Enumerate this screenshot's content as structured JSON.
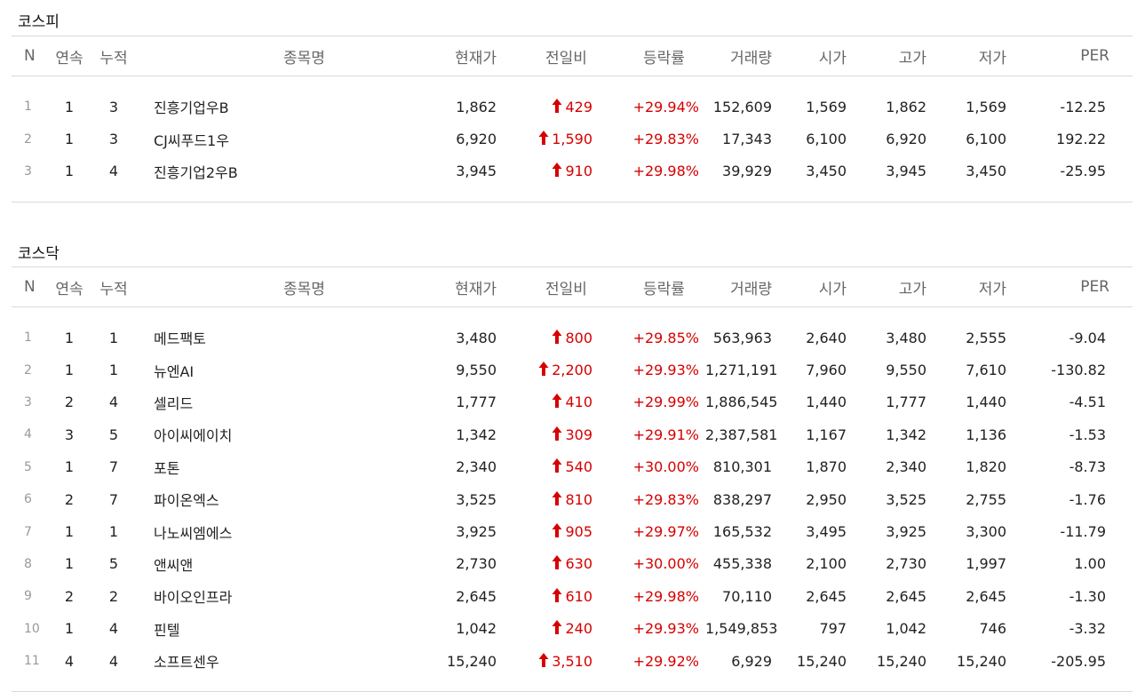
{
  "colors": {
    "up": "#d60000",
    "border": "#d9d9d9",
    "header_text": "#666666"
  },
  "kospi": {
    "title": "코스피",
    "headers": [
      "N",
      "연속",
      "누적",
      "종목명",
      "현재가",
      "전일비",
      "등락률",
      "거래량",
      "시가",
      "고가",
      "저가",
      "PER"
    ],
    "rows": [
      {
        "n": "1",
        "streak": "1",
        "total": "3",
        "name": "진흥기업우B",
        "price": "1,862",
        "change": "429",
        "rate": "+29.94%",
        "volume": "152,609",
        "open": "1,569",
        "high": "1,862",
        "low": "1,569",
        "per": "-12.25"
      },
      {
        "n": "2",
        "streak": "1",
        "total": "3",
        "name": "CJ씨푸드1우",
        "price": "6,920",
        "change": "1,590",
        "rate": "+29.83%",
        "volume": "17,343",
        "open": "6,100",
        "high": "6,920",
        "low": "6,100",
        "per": "192.22"
      },
      {
        "n": "3",
        "streak": "1",
        "total": "4",
        "name": "진흥기업2우B",
        "price": "3,945",
        "change": "910",
        "rate": "+29.98%",
        "volume": "39,929",
        "open": "3,450",
        "high": "3,945",
        "low": "3,450",
        "per": "-25.95"
      }
    ]
  },
  "kosdaq": {
    "title": "코스닥",
    "headers": [
      "N",
      "연속",
      "누적",
      "종목명",
      "현재가",
      "전일비",
      "등락률",
      "거래량",
      "시가",
      "고가",
      "저가",
      "PER"
    ],
    "rows": [
      {
        "n": "1",
        "streak": "1",
        "total": "1",
        "name": "메드팩토",
        "price": "3,480",
        "change": "800",
        "rate": "+29.85%",
        "volume": "563,963",
        "open": "2,640",
        "high": "3,480",
        "low": "2,555",
        "per": "-9.04"
      },
      {
        "n": "2",
        "streak": "1",
        "total": "1",
        "name": "뉴엔AI",
        "price": "9,550",
        "change": "2,200",
        "rate": "+29.93%",
        "volume": "1,271,191",
        "open": "7,960",
        "high": "9,550",
        "low": "7,610",
        "per": "-130.82"
      },
      {
        "n": "3",
        "streak": "2",
        "total": "4",
        "name": "셀리드",
        "price": "1,777",
        "change": "410",
        "rate": "+29.99%",
        "volume": "1,886,545",
        "open": "1,440",
        "high": "1,777",
        "low": "1,440",
        "per": "-4.51"
      },
      {
        "n": "4",
        "streak": "3",
        "total": "5",
        "name": "아이씨에이치",
        "price": "1,342",
        "change": "309",
        "rate": "+29.91%",
        "volume": "2,387,581",
        "open": "1,167",
        "high": "1,342",
        "low": "1,136",
        "per": "-1.53"
      },
      {
        "n": "5",
        "streak": "1",
        "total": "7",
        "name": "포톤",
        "price": "2,340",
        "change": "540",
        "rate": "+30.00%",
        "volume": "810,301",
        "open": "1,870",
        "high": "2,340",
        "low": "1,820",
        "per": "-8.73"
      },
      {
        "n": "6",
        "streak": "2",
        "total": "7",
        "name": "파이온엑스",
        "price": "3,525",
        "change": "810",
        "rate": "+29.83%",
        "volume": "838,297",
        "open": "2,950",
        "high": "3,525",
        "low": "2,755",
        "per": "-1.76"
      },
      {
        "n": "7",
        "streak": "1",
        "total": "1",
        "name": "나노씨엠에스",
        "price": "3,925",
        "change": "905",
        "rate": "+29.97%",
        "volume": "165,532",
        "open": "3,495",
        "high": "3,925",
        "low": "3,300",
        "per": "-11.79"
      },
      {
        "n": "8",
        "streak": "1",
        "total": "5",
        "name": "앤씨앤",
        "price": "2,730",
        "change": "630",
        "rate": "+30.00%",
        "volume": "455,338",
        "open": "2,100",
        "high": "2,730",
        "low": "1,997",
        "per": "1.00"
      },
      {
        "n": "9",
        "streak": "2",
        "total": "2",
        "name": "바이오인프라",
        "price": "2,645",
        "change": "610",
        "rate": "+29.98%",
        "volume": "70,110",
        "open": "2,645",
        "high": "2,645",
        "low": "2,645",
        "per": "-1.30"
      },
      {
        "n": "10",
        "streak": "1",
        "total": "4",
        "name": "핀텔",
        "price": "1,042",
        "change": "240",
        "rate": "+29.93%",
        "volume": "1,549,853",
        "open": "797",
        "high": "1,042",
        "low": "746",
        "per": "-3.32"
      },
      {
        "n": "11",
        "streak": "4",
        "total": "4",
        "name": "소프트센우",
        "price": "15,240",
        "change": "3,510",
        "rate": "+29.92%",
        "volume": "6,929",
        "open": "15,240",
        "high": "15,240",
        "low": "15,240",
        "per": "-205.95"
      }
    ]
  }
}
